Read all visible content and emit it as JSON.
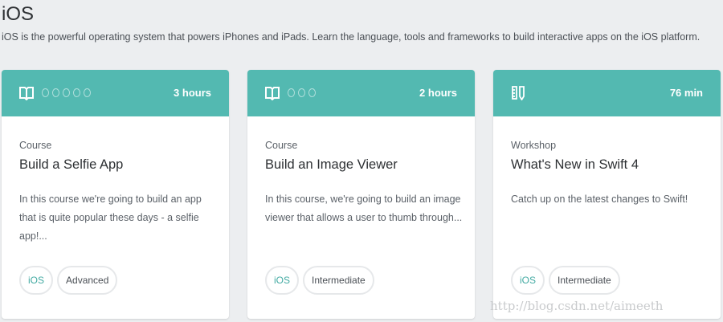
{
  "page": {
    "title": "iOS",
    "description": "iOS is the powerful operating system that powers iPhones and iPads. Learn the language, tools and frameworks to build interactive apps on the iOS platform."
  },
  "colors": {
    "accent": "#53b9b1",
    "background": "#eceef0"
  },
  "cards": [
    {
      "icon": "book-icon",
      "dots": 5,
      "duration": "3 hours",
      "type": "Course",
      "title": "Build a Selfie App",
      "text": "In this course we're going to build an app that is quite popular these days - a selfie app!...",
      "tags": [
        "iOS",
        "Advanced"
      ]
    },
    {
      "icon": "book-icon",
      "dots": 3,
      "duration": "2 hours",
      "type": "Course",
      "title": "Build an Image Viewer",
      "text": "In this course, we're going to build an image viewer that allows a user to thumb through...",
      "tags": [
        "iOS",
        "Intermediate"
      ]
    },
    {
      "icon": "ruler-pencil-icon",
      "dots": 0,
      "duration": "76 min",
      "type": "Workshop",
      "title": "What's New in Swift 4",
      "text": "Catch up on the latest changes to Swift!",
      "tags": [
        "iOS",
        "Intermediate"
      ]
    }
  ],
  "watermark": "http://blog.csdn.net/aimeeth"
}
